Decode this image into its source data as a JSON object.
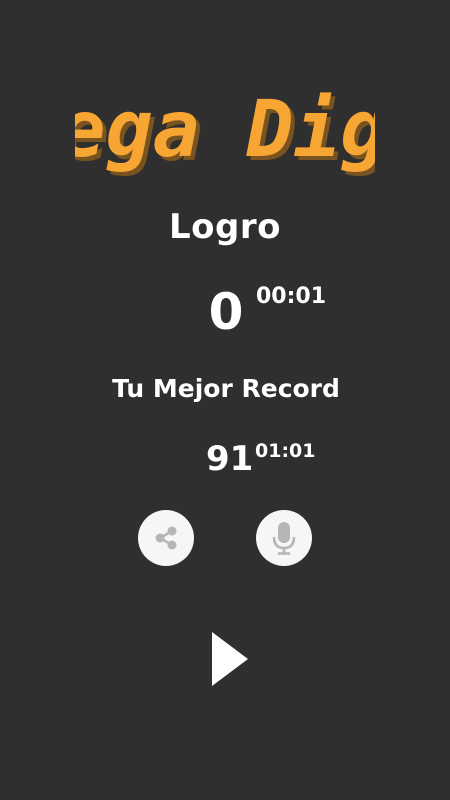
{
  "logo": {
    "text": "Mega Diga",
    "color": "#f7a533",
    "shadow_color": "#7a5420"
  },
  "score": {
    "label": "Logro",
    "value": "0",
    "time": "00:01"
  },
  "best": {
    "label": "Tu Mejor Record",
    "value": "91",
    "time": "01:01"
  },
  "buttons": {
    "share_icon": "share-icon",
    "mic_icon": "microphone-icon",
    "play_icon": "play-icon"
  },
  "colors": {
    "background": "#2f2f2f",
    "text": "#ffffff",
    "button_fill": "#f6f6f6",
    "icon_gray": "#b5b5b5"
  }
}
